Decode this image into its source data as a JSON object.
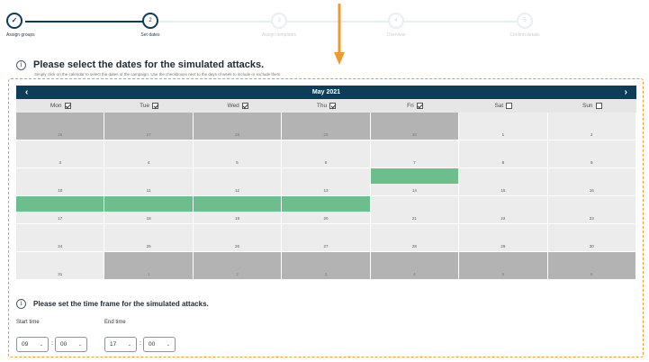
{
  "stepper": {
    "steps": [
      {
        "label": "Assign groups",
        "marker": "✓",
        "state": "done"
      },
      {
        "label": "Set dates",
        "marker": "2",
        "state": "current"
      },
      {
        "label": "Assign templates",
        "marker": "3",
        "state": "future"
      },
      {
        "label": "Overview",
        "marker": "4",
        "state": "future"
      },
      {
        "label": "Confirm details",
        "marker": "5",
        "state": "future"
      }
    ]
  },
  "dates_section": {
    "title": "Please select the dates for the simulated attacks.",
    "hint": "Simply click on the calendar to select the dates of the campaign. Use the checkboxes next to the days of week to include or exclude them."
  },
  "calendar": {
    "month_label": "May 2021",
    "prev_icon": "‹",
    "next_icon": "›",
    "weekdays": [
      {
        "label": "Mon",
        "checked": true
      },
      {
        "label": "Tue",
        "checked": true
      },
      {
        "label": "Wed",
        "checked": true
      },
      {
        "label": "Thu",
        "checked": true
      },
      {
        "label": "Fri",
        "checked": true
      },
      {
        "label": "Sat",
        "checked": false
      },
      {
        "label": "Sun",
        "checked": false
      }
    ],
    "weeks": [
      [
        {
          "d": "26",
          "s": "disabled"
        },
        {
          "d": "27",
          "s": "disabled"
        },
        {
          "d": "28",
          "s": "disabled"
        },
        {
          "d": "29",
          "s": "disabled"
        },
        {
          "d": "30",
          "s": "disabled"
        },
        {
          "d": "1",
          "s": "enabled"
        },
        {
          "d": "2",
          "s": "enabled"
        }
      ],
      [
        {
          "d": "3",
          "s": "enabled"
        },
        {
          "d": "4",
          "s": "enabled"
        },
        {
          "d": "5",
          "s": "enabled"
        },
        {
          "d": "6",
          "s": "enabled"
        },
        {
          "d": "7",
          "s": "enabled"
        },
        {
          "d": "8",
          "s": "enabled"
        },
        {
          "d": "9",
          "s": "enabled"
        }
      ],
      [
        {
          "d": "10",
          "s": "enabled"
        },
        {
          "d": "11",
          "s": "enabled"
        },
        {
          "d": "12",
          "s": "enabled"
        },
        {
          "d": "13",
          "s": "enabled"
        },
        {
          "d": "14",
          "s": "selected"
        },
        {
          "d": "15",
          "s": "enabled"
        },
        {
          "d": "16",
          "s": "enabled"
        }
      ],
      [
        {
          "d": "17",
          "s": "selected"
        },
        {
          "d": "18",
          "s": "selected"
        },
        {
          "d": "19",
          "s": "selected"
        },
        {
          "d": "20",
          "s": "selected"
        },
        {
          "d": "21",
          "s": "enabled"
        },
        {
          "d": "22",
          "s": "enabled"
        },
        {
          "d": "23",
          "s": "enabled"
        }
      ],
      [
        {
          "d": "24",
          "s": "enabled"
        },
        {
          "d": "25",
          "s": "enabled"
        },
        {
          "d": "26",
          "s": "enabled"
        },
        {
          "d": "27",
          "s": "enabled"
        },
        {
          "d": "28",
          "s": "enabled"
        },
        {
          "d": "29",
          "s": "enabled"
        },
        {
          "d": "30",
          "s": "enabled"
        }
      ],
      [
        {
          "d": "31",
          "s": "enabled"
        },
        {
          "d": "1",
          "s": "disabled"
        },
        {
          "d": "2",
          "s": "disabled"
        },
        {
          "d": "3",
          "s": "disabled"
        },
        {
          "d": "4",
          "s": "disabled"
        },
        {
          "d": "5",
          "s": "disabled"
        },
        {
          "d": "6",
          "s": "disabled"
        }
      ]
    ]
  },
  "time_section": {
    "title": "Please set the time frame for the simulated attacks.",
    "start_label": "Start time",
    "end_label": "End time",
    "start_hour": "09",
    "start_minute": "00",
    "end_hour": "17",
    "end_minute": "00",
    "separator": ":",
    "caret_icon": "⌄"
  },
  "colors": {
    "header_bg": "#0e3e57",
    "selected_green": "#6dbe8d",
    "disabled_gray": "#b3b3b3",
    "enabled_gray": "#ececec",
    "highlight_orange": "#ef9a2d"
  }
}
